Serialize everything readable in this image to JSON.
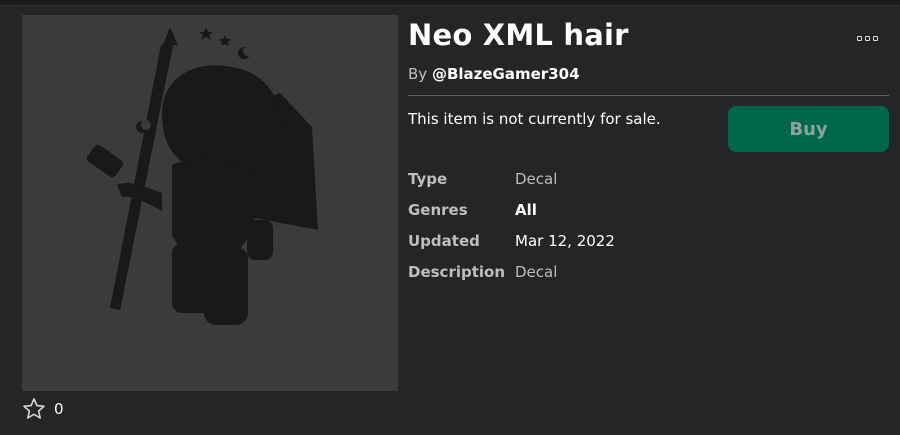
{
  "item": {
    "title": "Neo XML hair",
    "by_prefix": "By",
    "creator": "@BlazeGamer304",
    "sale_status": "This item is not currently for sale.",
    "buy_label": "Buy",
    "favorite_count": "0"
  },
  "details": [
    {
      "label": "Type",
      "value": "Decal"
    },
    {
      "label": "Genres",
      "value": "All"
    },
    {
      "label": "Updated",
      "value": "Mar 12, 2022"
    },
    {
      "label": "Description",
      "value": "Decal"
    }
  ],
  "colors": {
    "background": "#232527",
    "thumbnail_bg": "#393b3d",
    "buy_button": "#00684a",
    "divider": "#5c5e61"
  },
  "icons": {
    "more": "more-options-icon",
    "favorite": "star-outline-icon"
  }
}
